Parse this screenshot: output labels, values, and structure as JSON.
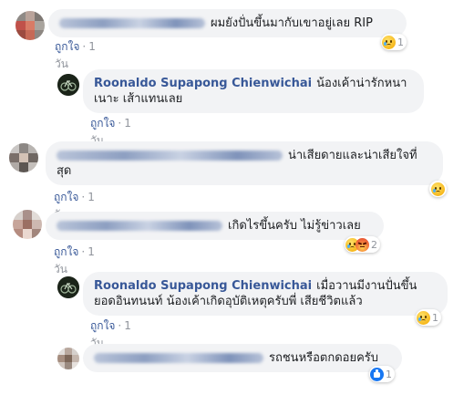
{
  "actions": {
    "like_label": "ถูกใจ",
    "separator": "·",
    "time": "1 วัน"
  },
  "comments": [
    {
      "id": "c1",
      "text": "ผมยังปั่นขึ้นมากับเขาอยู่เลย RIP",
      "reaction_count": "1",
      "reactions": [
        "sad-icon"
      ]
    },
    {
      "id": "r1",
      "author": "Roonaldo Supapong Chienwichai",
      "text_line1": "น้องเค้าน่ารักหนา",
      "text_line2": "เนาะ เส้าแทนเลย"
    },
    {
      "id": "c2",
      "text_line1": "น่าเสียดายและน่าเสียใจที่",
      "text_line2": "สุด",
      "reactions": [
        "sad-icon"
      ]
    },
    {
      "id": "c3",
      "text": "เกิดไรขึ้นครับ ไม่รู้ข่าวเลย",
      "reaction_count": "2",
      "reactions": [
        "sad-icon",
        "angry-icon"
      ]
    },
    {
      "id": "r2",
      "author": "Roonaldo Supapong Chienwichai",
      "text_line1": "เมื่อวานมีงานปั่นขึ้น",
      "text_line2": "ยอดอินทนนท์ น้องเค้าเกิดอุบัติเหตุครับพี่ เสียชีวิตแล้ว",
      "reaction_count": "1",
      "reactions": [
        "sad-icon"
      ]
    },
    {
      "id": "r3",
      "text": "รถชนหรือตกดอยครับ",
      "reaction_count": "1",
      "reactions": [
        "like-icon"
      ]
    }
  ],
  "colors": {
    "link_blue": "#385898",
    "bubble_gray": "#f2f3f5",
    "meta_gray": "#90949c"
  }
}
